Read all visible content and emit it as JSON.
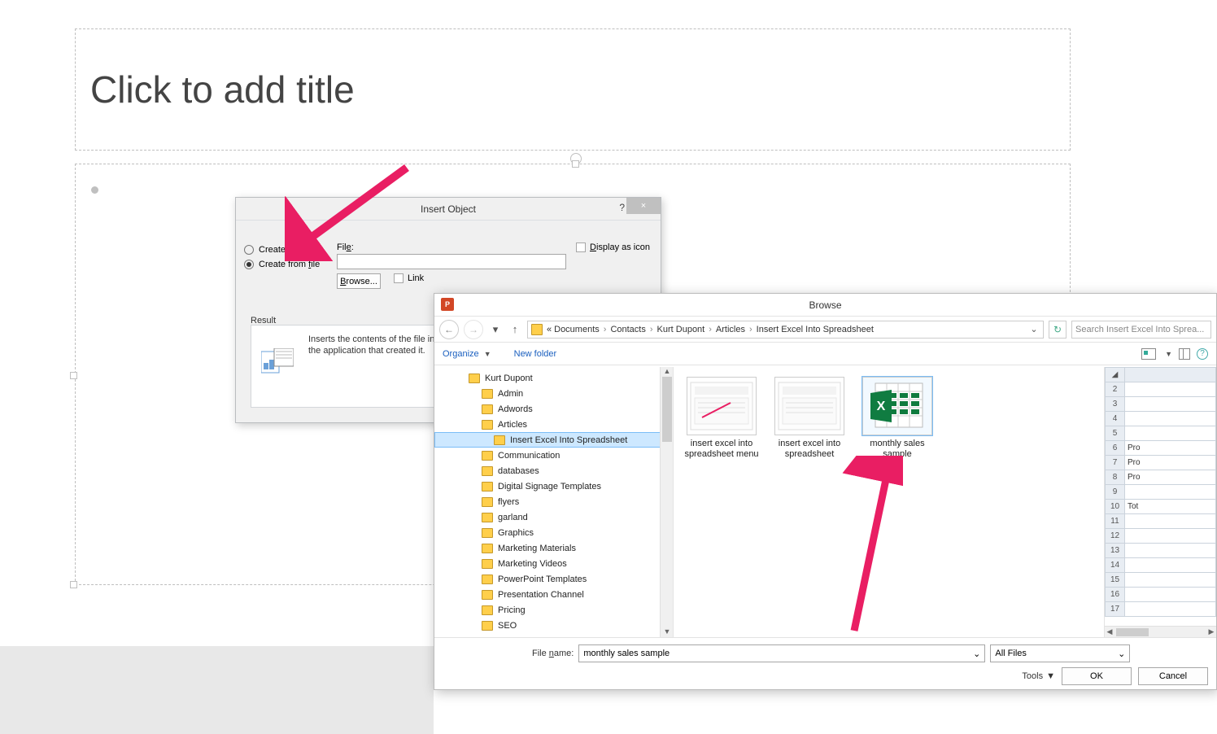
{
  "slide": {
    "title_placeholder": "Click to add title"
  },
  "insert_object": {
    "title": "Insert Object",
    "help": "?",
    "close": "×",
    "radio_create_new": "Create new",
    "radio_create_from_file": "Create from file",
    "file_label": "File:",
    "file_value": "",
    "browse_btn": "Browse...",
    "link_label": "Link",
    "display_as_icon": "Display as icon",
    "result_label": "Result",
    "result_text": "Inserts the contents of the file into your presentation so that you can activate it using the application that created it."
  },
  "browse": {
    "title": "Browse",
    "app_badge": "P",
    "breadcrumb": {
      "prefix": "«",
      "parts": [
        "Documents",
        "Contacts",
        "Kurt Dupont",
        "Articles",
        "Insert Excel Into Spreadsheet"
      ]
    },
    "search_placeholder": "Search Insert Excel Into Sprea...",
    "organize": "Organize",
    "new_folder": "New folder",
    "tree": [
      {
        "label": "Kurt Dupont",
        "indent": 1
      },
      {
        "label": "Admin",
        "indent": 2
      },
      {
        "label": "Adwords",
        "indent": 2
      },
      {
        "label": "Articles",
        "indent": 2
      },
      {
        "label": "Insert Excel Into Spreadsheet",
        "indent": 3,
        "selected": true
      },
      {
        "label": "Communication",
        "indent": 2
      },
      {
        "label": "databases",
        "indent": 2
      },
      {
        "label": "Digital Signage Templates",
        "indent": 2
      },
      {
        "label": "flyers",
        "indent": 2
      },
      {
        "label": "garland",
        "indent": 2
      },
      {
        "label": "Graphics",
        "indent": 2
      },
      {
        "label": "Marketing Materials",
        "indent": 2
      },
      {
        "label": "Marketing Videos",
        "indent": 2
      },
      {
        "label": "PowerPoint Templates",
        "indent": 2
      },
      {
        "label": "Presentation Channel",
        "indent": 2
      },
      {
        "label": "Pricing",
        "indent": 2
      },
      {
        "label": "SEO",
        "indent": 2
      }
    ],
    "files": [
      {
        "name": "insert excel into spreadsheet menu",
        "type": "image"
      },
      {
        "name": "insert excel into spreadsheet",
        "type": "image"
      },
      {
        "name": "monthly sales sample",
        "type": "excel",
        "selected": true
      }
    ],
    "preview_rows": [
      {
        "n": "2",
        "v": ""
      },
      {
        "n": "3",
        "v": ""
      },
      {
        "n": "4",
        "v": ""
      },
      {
        "n": "5",
        "v": ""
      },
      {
        "n": "6",
        "v": "Pro"
      },
      {
        "n": "7",
        "v": "Pro"
      },
      {
        "n": "8",
        "v": "Pro"
      },
      {
        "n": "9",
        "v": ""
      },
      {
        "n": "10",
        "v": "Tot"
      },
      {
        "n": "11",
        "v": ""
      },
      {
        "n": "12",
        "v": ""
      },
      {
        "n": "13",
        "v": ""
      },
      {
        "n": "14",
        "v": ""
      },
      {
        "n": "15",
        "v": ""
      },
      {
        "n": "16",
        "v": ""
      },
      {
        "n": "17",
        "v": ""
      }
    ],
    "file_name_label": "File name:",
    "file_name_value": "monthly sales sample",
    "filter": "All Files",
    "tools": "Tools",
    "ok": "OK",
    "cancel": "Cancel"
  }
}
